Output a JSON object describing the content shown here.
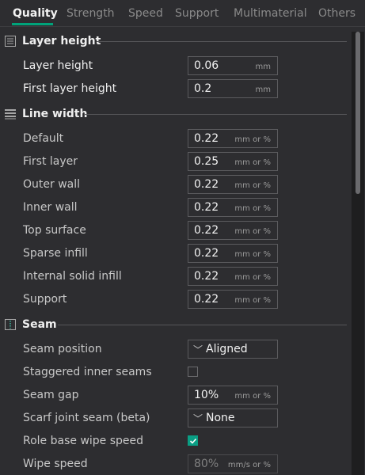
{
  "tabs": [
    {
      "label": "Quality"
    },
    {
      "label": "Strength"
    },
    {
      "label": "Speed"
    },
    {
      "label": "Support"
    },
    {
      "label": "Multimaterial"
    },
    {
      "label": "Others"
    }
  ],
  "accent_color": "#00a37a",
  "sections": {
    "layer_height": {
      "title": "Layer height",
      "icon": "layer-height-icon",
      "rows": [
        {
          "label": "Layer height",
          "value": "0.06",
          "unit": "mm"
        },
        {
          "label": "First layer height",
          "value": "0.2",
          "unit": "mm"
        }
      ]
    },
    "line_width": {
      "title": "Line width",
      "icon": "line-width-icon",
      "rows": [
        {
          "label": "Default",
          "value": "0.22",
          "unit": "mm or %"
        },
        {
          "label": "First layer",
          "value": "0.25",
          "unit": "mm or %"
        },
        {
          "label": "Outer wall",
          "value": "0.22",
          "unit": "mm or %"
        },
        {
          "label": "Inner wall",
          "value": "0.22",
          "unit": "mm or %"
        },
        {
          "label": "Top surface",
          "value": "0.22",
          "unit": "mm or %"
        },
        {
          "label": "Sparse infill",
          "value": "0.22",
          "unit": "mm or %"
        },
        {
          "label": "Internal solid infill",
          "value": "0.22",
          "unit": "mm or %"
        },
        {
          "label": "Support",
          "value": "0.22",
          "unit": "mm or %"
        }
      ]
    },
    "seam": {
      "title": "Seam",
      "icon": "seam-icon",
      "seam_position": {
        "label": "Seam position",
        "value": "Aligned"
      },
      "staggered": {
        "label": "Staggered inner seams",
        "checked": false
      },
      "seam_gap": {
        "label": "Seam gap",
        "value": "10%",
        "unit": "mm or %"
      },
      "scarf": {
        "label": "Scarf joint seam (beta)",
        "value": "None"
      },
      "role_base": {
        "label": "Role base wipe speed",
        "checked": true
      },
      "wipe_speed": {
        "label": "Wipe speed",
        "value": "80%",
        "unit": "mm/s or %"
      }
    }
  }
}
